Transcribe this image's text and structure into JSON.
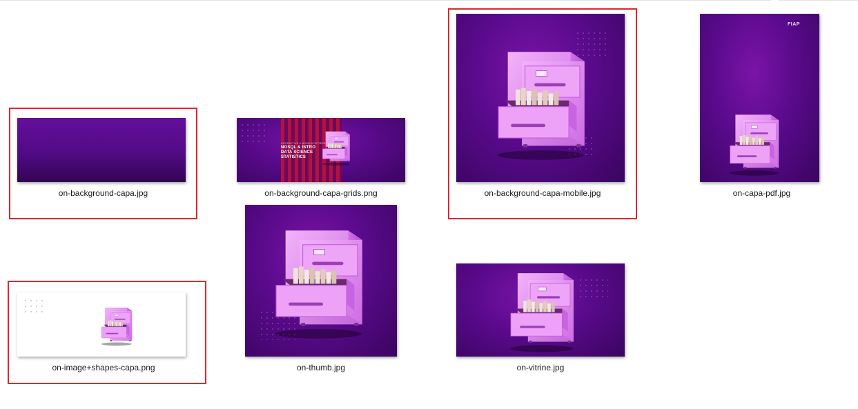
{
  "files": [
    {
      "name": "on-background-capa.jpg",
      "selected": true
    },
    {
      "name": "on-background-capa-grids.png",
      "selected": false
    },
    {
      "name": "on-background-capa-mobile.jpg",
      "selected": true
    },
    {
      "name": "on-capa-pdf.jpg",
      "selected": false
    },
    {
      "name": "on-image+shapes-capa.png",
      "selected": true
    },
    {
      "name": "on-thumb.jpg",
      "selected": false
    },
    {
      "name": "on-vitrine.jpg",
      "selected": false
    }
  ],
  "grids_preview": {
    "kicker": "INTERACTIVE & MODELS PATTERNS",
    "line1": "NOSQL & INTRO",
    "line2": "DATA SCIENCE",
    "line3": "STATISTICS"
  },
  "pdf_preview": {
    "logo": "FIAP"
  },
  "colors": {
    "selection_border": "#e0262f",
    "thumb_purple": "#5a0a8c",
    "cabinet_pink": "#e08af0"
  }
}
